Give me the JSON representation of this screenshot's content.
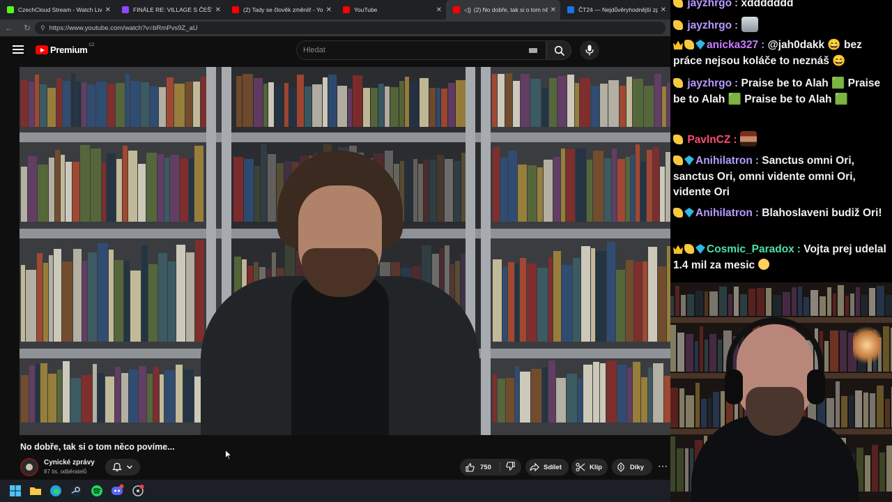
{
  "browser": {
    "tabs": [
      {
        "title": "CzechCloud Stream - Watch Live o",
        "favicon_color": "#53fc18",
        "active": false
      },
      {
        "title": "FINÁLE RE: VILLAGE S ČEŠTINO",
        "favicon_color": "#9146ff",
        "active": false
      },
      {
        "title": "(2) Tady se člověk změnil! - YouTub",
        "favicon_color": "#ff0000",
        "active": false
      },
      {
        "title": "YouTube",
        "favicon_color": "#ff0000",
        "active": false
      },
      {
        "title": "(2) No dobře, tak si o tom ně",
        "favicon_color": "#ff0000",
        "active": true
      },
      {
        "title": "ČT24 — Nejdůvěryhodnější zprav",
        "favicon_color": "#1a73e8",
        "active": false
      }
    ],
    "url": "https://www.youtube.com/watch?v=bRmPvs9Z_aU"
  },
  "youtube": {
    "logo_text": "Premium",
    "region": "CZ",
    "search_placeholder": "Hledat",
    "video_title": "No dobře, tak si o tom něco povíme...",
    "channel_name": "Cynické zprávy",
    "channel_subs": "87 tis. odběratelů",
    "like_count": "750",
    "share_label": "Sdílet",
    "clip_label": "Klip",
    "thanks_label": "Díky",
    "more_label": "⋯"
  },
  "chat": {
    "messages": [
      {
        "badges": [
          "clap"
        ],
        "user": "jayzhrgo",
        "color": "#b59cff",
        "text": "xddddddd"
      },
      {
        "badges": [
          "clap"
        ],
        "user": "jayzhrgo",
        "color": "#b59cff",
        "text": "",
        "emotes": [
          "robot"
        ]
      },
      {
        "badges": [
          "crown",
          "clap",
          "gem"
        ],
        "user": "anicka327",
        "color": "#c77dff",
        "text": "@jah0dakk 😄 bez práce nejsou koláče to neznáš 😄"
      },
      {
        "badges": [
          "clap"
        ],
        "user": "jayzhrgo",
        "color": "#b59cff",
        "text": "Praise be to Alah 🟩 Praise be to Alah 🟩 Praise be to Alah 🟩"
      },
      {
        "badges": [
          "clap"
        ],
        "user": "PavlnCZ",
        "color": "#ff4d6d",
        "text": ""
      },
      {
        "badges": [
          "clap",
          "gem"
        ],
        "user": "Anihilatron",
        "color": "#b59cff",
        "text": "Sanctus omni Ori, sanctus Ori, omni vidente omni Ori, vidente Ori"
      },
      {
        "badges": [
          "clap",
          "gem"
        ],
        "user": "Anihilatron",
        "color": "#b59cff",
        "text": "Blahoslaveni budiž Ori!"
      },
      {
        "badges": [
          "crown",
          "clap",
          "gem"
        ],
        "user": "Cosmic_Paradox",
        "color": "#4be2a8",
        "text": "Vojta prej udelal 1.4 mil za mesic"
      }
    ]
  },
  "icons": [
    "menu-icon",
    "youtube-logo-icon",
    "keyboard-icon",
    "search-icon",
    "mic-icon",
    "bell-icon",
    "chevron-down-icon",
    "like-icon",
    "dislike-icon",
    "share-icon",
    "clip-icon",
    "thanks-icon",
    "more-icon"
  ]
}
